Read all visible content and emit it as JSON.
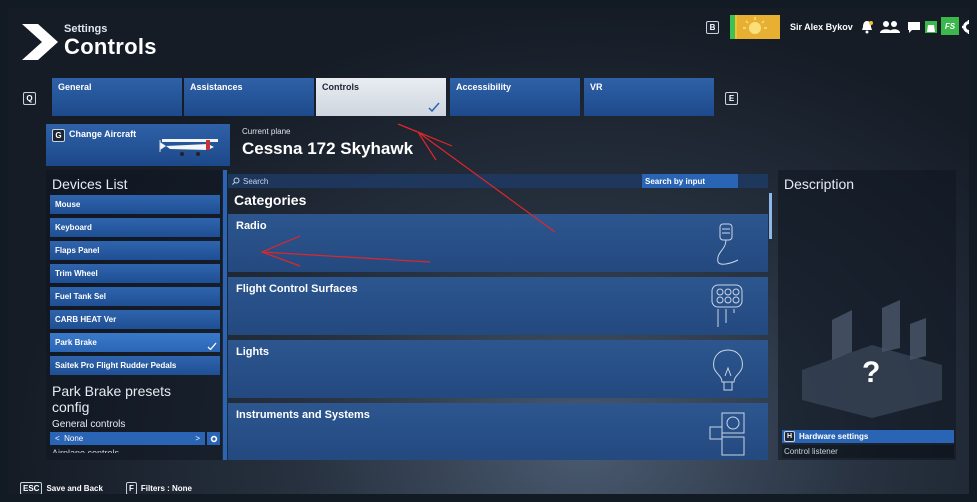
{
  "header": {
    "breadcrumb": "Settings",
    "title": "Controls",
    "keycap_left": "B",
    "user_name": "Sir Alex Bykov",
    "fs_badge": "FS"
  },
  "tabs": {
    "prev_key": "Q",
    "next_key": "E",
    "items": [
      {
        "label": "General"
      },
      {
        "label": "Assistances"
      },
      {
        "label": "Controls"
      },
      {
        "label": "Accessibility"
      },
      {
        "label": "VR"
      }
    ],
    "active": "Controls"
  },
  "aircraft": {
    "change_key": "G",
    "change_label": "Change Aircraft",
    "current_label": "Current plane",
    "current_plane": "Cessna 172 Skyhawk"
  },
  "devices": {
    "title": "Devices List",
    "items": [
      {
        "label": "Mouse"
      },
      {
        "label": "Keyboard"
      },
      {
        "label": "Flaps Panel"
      },
      {
        "label": "Trim Wheel"
      },
      {
        "label": "Fuel Tank Sel"
      },
      {
        "label": "CARB HEAT Ver"
      },
      {
        "label": "Park Brake"
      },
      {
        "label": "Saitek Pro Flight Rudder Pedals"
      }
    ],
    "selected": "Park Brake",
    "presets_title_line1": "Park Brake presets",
    "presets_title_line2": "config",
    "general_controls": "General controls",
    "preset_value": "None",
    "prev_arrow": "<",
    "next_arrow": ">",
    "cut_text": "Airplane controls"
  },
  "categories": {
    "search_placeholder": "Search",
    "search_by_input": "Search by input",
    "title": "Categories",
    "items": [
      {
        "label": "Radio",
        "icon": "radio-mic-icon"
      },
      {
        "label": "Flight Control Surfaces",
        "icon": "yoke-icon"
      },
      {
        "label": "Lights",
        "icon": "lightbulb-icon"
      },
      {
        "label": "Instruments and Systems",
        "icon": "instruments-icon"
      }
    ]
  },
  "description": {
    "title": "Description",
    "question_mark": "?",
    "hw_key": "H",
    "hw_label": "Hardware settings",
    "control_listener": "Control listener"
  },
  "bottom": {
    "esc_key": "ESC",
    "esc_label": "Save and Back",
    "f_key": "F",
    "f_label": "Filters : None"
  },
  "colors": {
    "accent_blue": "#2a64b4",
    "annotation_red": "#e0262a",
    "fs_green": "#3bb84b"
  }
}
